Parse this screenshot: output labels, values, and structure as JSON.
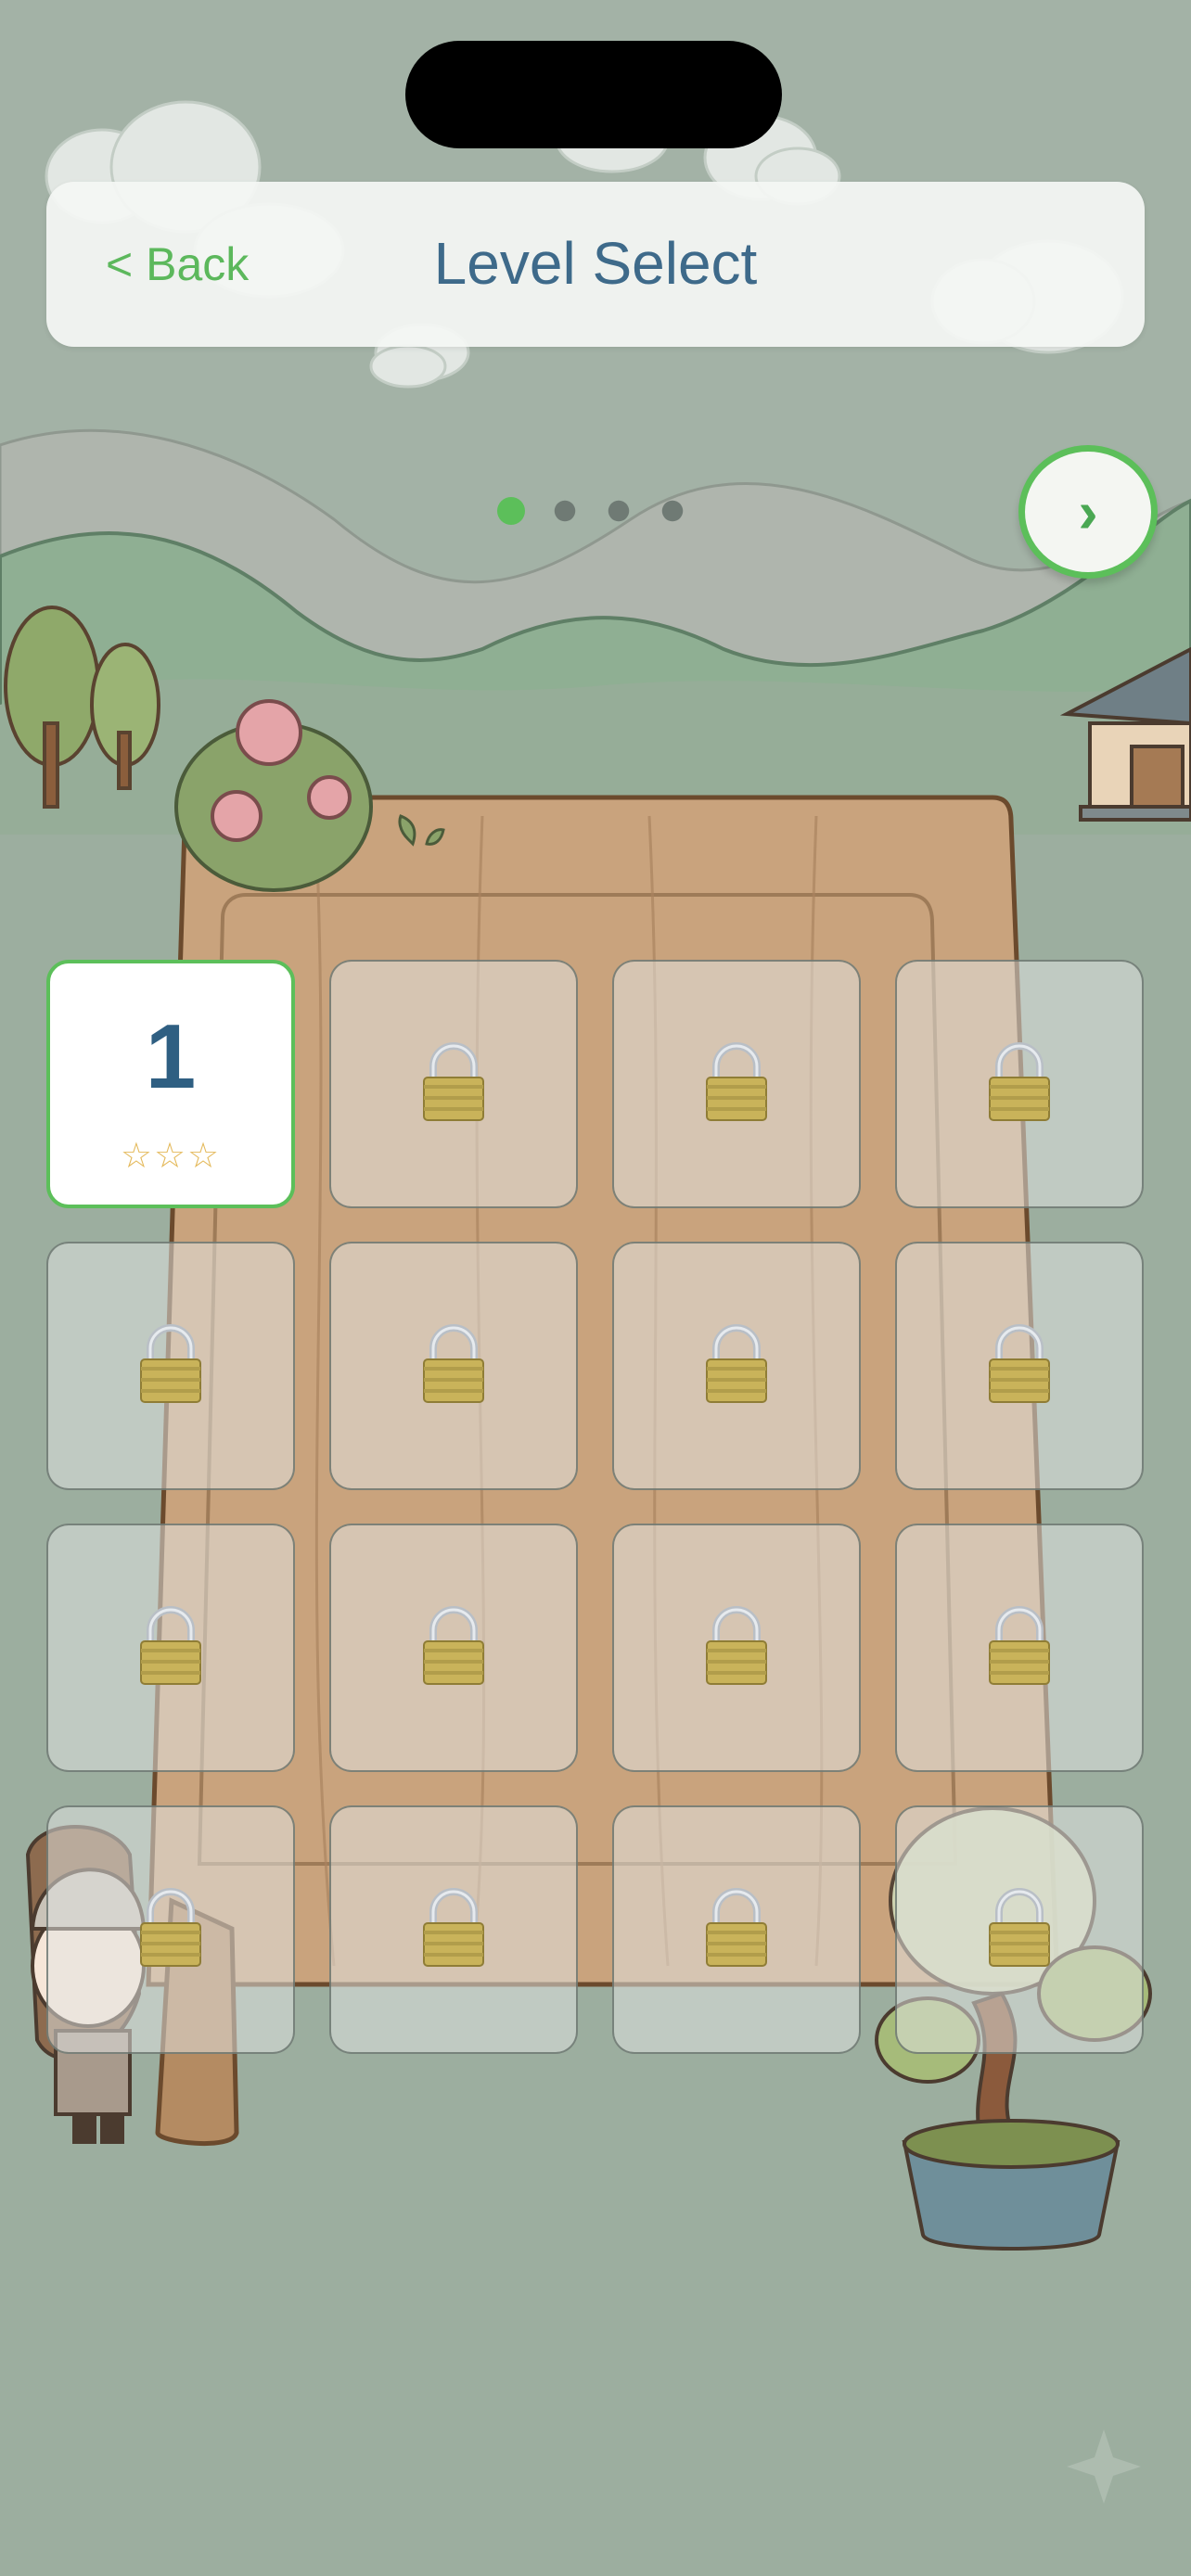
{
  "header": {
    "back_label": "< Back",
    "title": "Level Select"
  },
  "pager": {
    "pages": 4,
    "active": 0,
    "next_label": "›"
  },
  "levels": [
    {
      "label": "1",
      "locked": false,
      "stars": "☆☆☆"
    },
    {
      "locked": true,
      "icon": "lock-icon"
    },
    {
      "locked": true,
      "icon": "lock-icon"
    },
    {
      "locked": true,
      "icon": "lock-icon"
    },
    {
      "locked": true,
      "icon": "lock-icon"
    },
    {
      "locked": true,
      "icon": "lock-icon"
    },
    {
      "locked": true,
      "icon": "lock-icon"
    },
    {
      "locked": true,
      "icon": "lock-icon"
    },
    {
      "locked": true,
      "icon": "lock-icon"
    },
    {
      "locked": true,
      "icon": "lock-icon"
    },
    {
      "locked": true,
      "icon": "lock-icon"
    },
    {
      "locked": true,
      "icon": "lock-icon"
    },
    {
      "locked": true,
      "icon": "lock-icon"
    },
    {
      "locked": true,
      "icon": "lock-icon"
    },
    {
      "locked": true,
      "icon": "lock-icon"
    },
    {
      "locked": true,
      "icon": "lock-icon"
    }
  ],
  "colors": {
    "accent": "#5cbf5a",
    "title": "#3e6a8a",
    "level_number": "#2f5f82",
    "star": "#e4b95a",
    "background": "#9cae9f"
  }
}
